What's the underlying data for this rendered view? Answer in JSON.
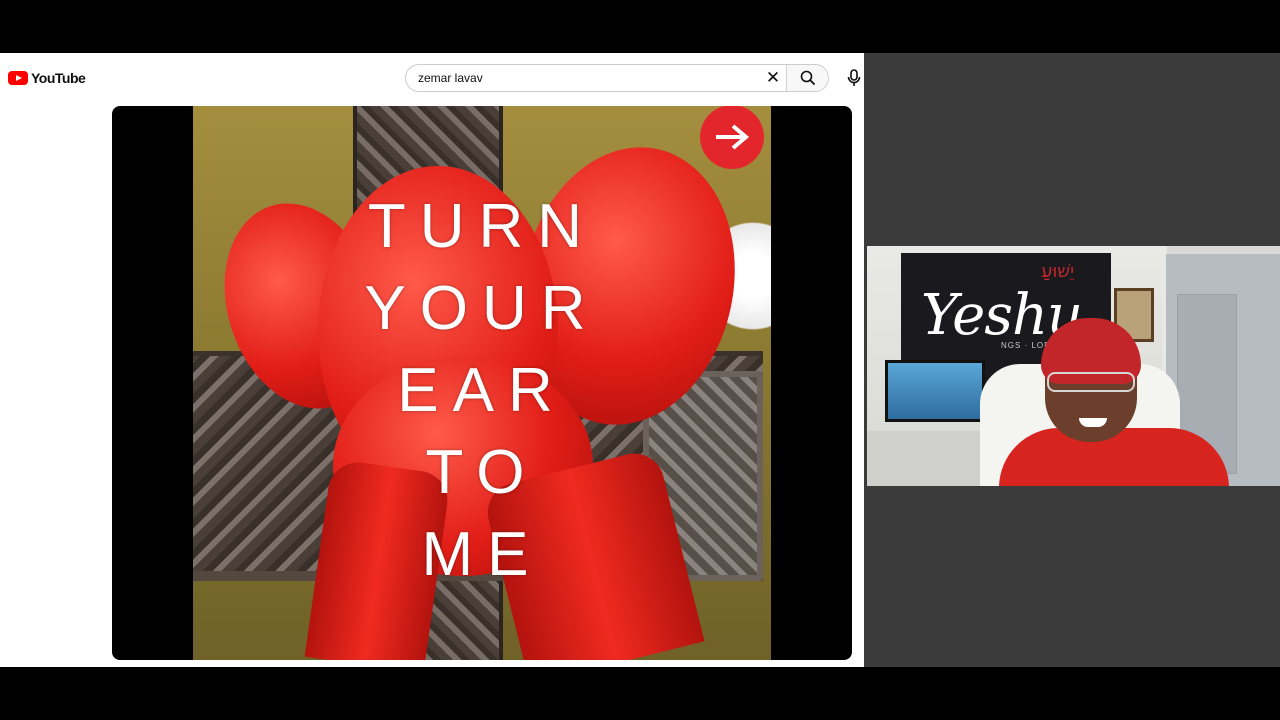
{
  "youtube": {
    "logo_text": "YouTube",
    "search": {
      "value": "zemar lavav",
      "clear_icon": "close-icon",
      "search_icon": "search-icon",
      "mic_icon": "mic-icon"
    }
  },
  "video": {
    "lyrics": [
      "TURN",
      "YOUR",
      "EAR",
      "TO",
      "ME"
    ],
    "next_icon": "arrow-right-icon",
    "accent_color": "#e3262c"
  },
  "webcam": {
    "banner_text": "Yeshu",
    "banner_hebrew": "יֵשׁוּעַ",
    "banner_subtext": "NGS · LORD"
  }
}
